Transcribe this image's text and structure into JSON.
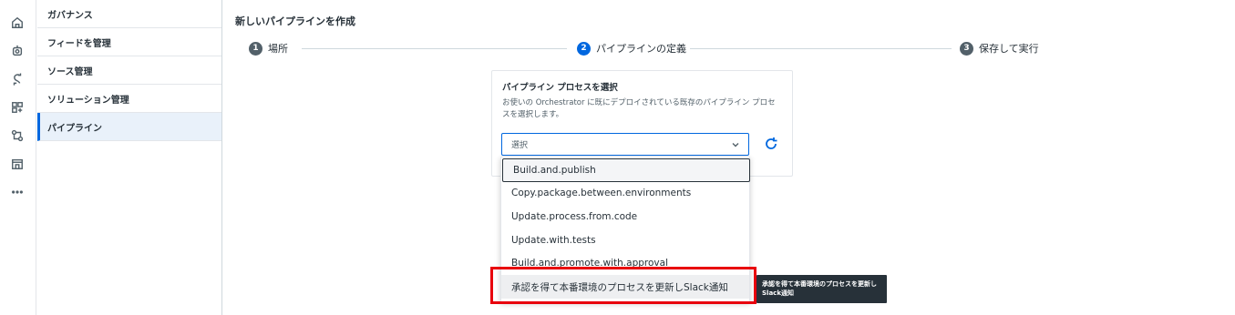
{
  "rail": {
    "icons": [
      "home-icon",
      "robot-icon",
      "sync-icon",
      "apps-icon",
      "integration-icon",
      "building-icon",
      "more-icon"
    ]
  },
  "sidebar": {
    "items": [
      {
        "label": "ガバナンス"
      },
      {
        "label": "フィードを管理"
      },
      {
        "label": "ソース管理"
      },
      {
        "label": "ソリューション管理"
      },
      {
        "label": "パイプライン"
      }
    ]
  },
  "page": {
    "title": "新しいパイプラインを作成"
  },
  "stepper": {
    "steps": [
      {
        "number": "1",
        "label": "場所"
      },
      {
        "number": "2",
        "label": "パイプラインの定義"
      },
      {
        "number": "3",
        "label": "保存して実行"
      }
    ]
  },
  "card": {
    "title": "パイプライン プロセスを選択",
    "description": "お使いの Orchestrator に既にデプロイされている既存のパイプライン プロセスを選択します。",
    "select_placeholder": "選択"
  },
  "dropdown": {
    "options": [
      "Build.and.publish",
      "Copy.package.between.environments",
      "Update.process.from.code",
      "Update.with.tests",
      "Build.and.promote.with.approval",
      "承認を得て本番環境のプロセスを更新しSlack通知"
    ]
  },
  "tooltip": {
    "text": "承認を得て本番環境のプロセスを更新しSlack通知"
  },
  "colors": {
    "accent": "#0067df",
    "highlight": "#e8000d",
    "text": "#273139"
  }
}
